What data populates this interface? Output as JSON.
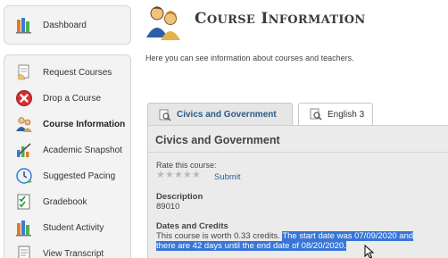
{
  "sidebar": {
    "dashboard": {
      "label": "Dashboard",
      "icon": "chart-books-icon"
    },
    "items": [
      {
        "label": "Request Courses",
        "icon": "form-hand-icon"
      },
      {
        "label": "Drop a Course",
        "icon": "red-x-icon"
      },
      {
        "label": "Course Information",
        "icon": "people-icon",
        "active": true
      },
      {
        "label": "Academic Snapshot",
        "icon": "chart-pen-icon"
      },
      {
        "label": "Suggested Pacing",
        "icon": "clock-arrow-icon"
      },
      {
        "label": "Gradebook",
        "icon": "checklist-icon"
      },
      {
        "label": "Student Activity",
        "icon": "chart-books-icon"
      },
      {
        "label": "View Transcript",
        "icon": "document-icon"
      }
    ]
  },
  "header": {
    "title_first_cap": "C",
    "title_first_rest": "OURSE",
    "title_second_cap": "I",
    "title_second_rest": "NFORMATION",
    "intro": "Here you can see information about courses and teachers."
  },
  "tabs": [
    {
      "label": "Civics and Government",
      "active": true
    },
    {
      "label": "English 3",
      "active": false
    }
  ],
  "course": {
    "title": "Civics and Government",
    "rate_label": "Rate this course:",
    "stars": "★★★★★",
    "submit_label": "Submit",
    "description_label": "Description",
    "description_value": "89010",
    "dates_label": "Dates and Credits",
    "credits_text": "This course is worth 0.33 credits. ",
    "selected_line1": "The start date was 07/09/2020 and",
    "selected_line2": "there are 42 days until the end date of 08/20/2020."
  },
  "colors": {
    "selection": "#3875d7",
    "link": "#2b5f9e",
    "tab_active_text": "#2a5a88"
  }
}
